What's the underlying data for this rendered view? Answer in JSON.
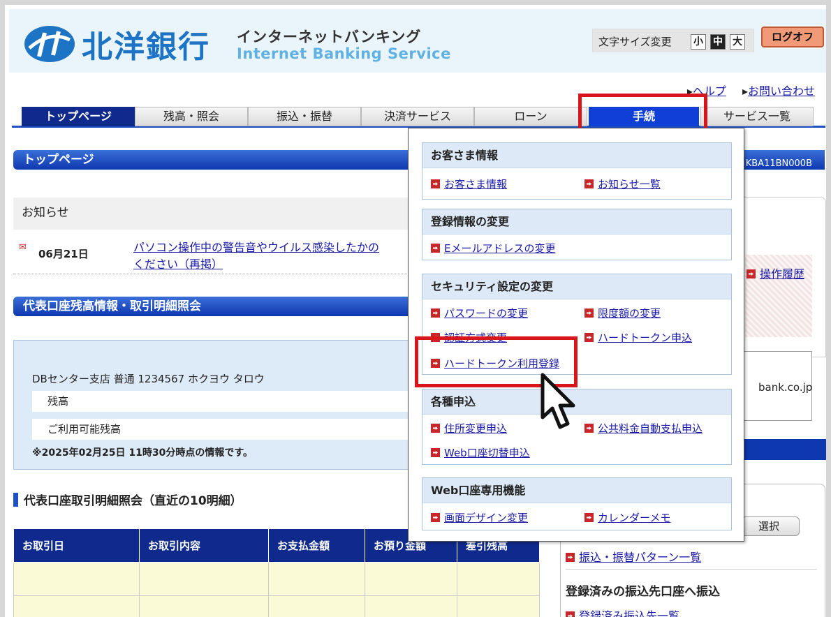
{
  "header": {
    "bank_name": "北洋銀行",
    "service_jp": "インターネットバンキング",
    "service_en": "Internet Banking Service",
    "font_size_label": "文字サイズ変更",
    "font_sizes": [
      "小",
      "中",
      "大"
    ],
    "logout": "ログオフ"
  },
  "help_links": [
    "ヘルプ",
    "お問い合わせ"
  ],
  "nav": {
    "tabs": [
      "トップページ",
      "残高・照会",
      "振込・振替",
      "決済サービス",
      "ローン",
      "手続",
      "サービス一覧"
    ]
  },
  "page": {
    "title": "トップページ",
    "screen_id": "KBA11BN000B"
  },
  "notice": {
    "heading": "お知らせ",
    "date": "06月21日",
    "text_line1": "パソコン操作中の警告音やウイルス感染したかの",
    "text_line2": "ください（再掲）"
  },
  "balance": {
    "heading": "代表口座残高情報・取引明細照会",
    "account": "DBセンター支店 普通 1234567 ホクヨウ タロウ",
    "balance_label": "残高",
    "available_label": "ご利用可能残高",
    "note": "※2025年02月25日 11時30分時点の情報です。"
  },
  "transactions": {
    "heading": "代表口座取引明細照会（直近の10明細）",
    "columns": [
      "お取引日",
      "お取引内容",
      "お支払金額",
      "お預り金額",
      "差引残高"
    ]
  },
  "right": {
    "history_link": "操作履歴",
    "email_fragment": "bank.co.jp",
    "select_button": "選択",
    "pattern_link": "振込・振替パターン一覧",
    "registered_heading": "登録済みの振込先口座へ振込",
    "registered_link": "登録済み振込先一覧"
  },
  "dropdown": {
    "groups": [
      {
        "title": "お客さま情報",
        "items": [
          "お客さま情報",
          "お知らせ一覧"
        ]
      },
      {
        "title": "登録情報の変更",
        "items": [
          "Eメールアドレスの変更"
        ]
      },
      {
        "title": "セキュリティ設定の変更",
        "items": [
          "パスワードの変更",
          "限度額の変更",
          "認証方式変更",
          "ハードトークン申込",
          "ハードトークン利用登録"
        ]
      },
      {
        "title": "各種申込",
        "items": [
          "住所変更申込",
          "公共料金自動支払申込",
          "Web口座切替申込"
        ]
      },
      {
        "title": "Web口座専用機能",
        "items": [
          "画面デザイン変更",
          "カレンダーメモ"
        ]
      }
    ]
  },
  "colors": {
    "highlight": "#d9151c",
    "nav_active": "#0f2a8c",
    "brand_blue": "#1d74c4"
  }
}
